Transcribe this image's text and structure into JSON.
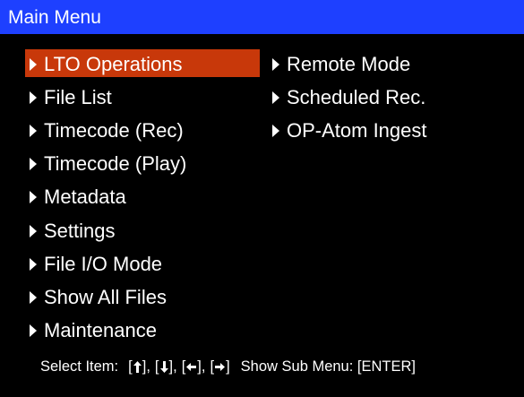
{
  "title": "Main Menu",
  "colors": {
    "title_bar": "#1e40ff",
    "selected": "#c8380a",
    "background": "#000000",
    "text": "#ffffff"
  },
  "menu": {
    "left": [
      {
        "label": "LTO Operations",
        "selected": true
      },
      {
        "label": "File List"
      },
      {
        "label": "Timecode (Rec)"
      },
      {
        "label": "Timecode (Play)"
      },
      {
        "label": "Metadata"
      },
      {
        "label": "Settings"
      },
      {
        "label": "File I/O Mode"
      },
      {
        "label": "Show All Files"
      },
      {
        "label": "Maintenance"
      }
    ],
    "right": [
      {
        "label": "Remote Mode"
      },
      {
        "label": "Scheduled Rec."
      },
      {
        "label": "OP-Atom Ingest"
      }
    ]
  },
  "footer": {
    "select_label": "Select Item:",
    "keys": [
      "up-arrow-icon",
      "down-arrow-icon",
      "left-arrow-icon",
      "right-arrow-icon"
    ],
    "submenu_label": "Show Sub Menu: [ENTER]"
  }
}
